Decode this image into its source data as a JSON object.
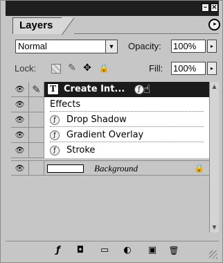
{
  "window": {
    "minimize_glyph": "–",
    "close_glyph": "×"
  },
  "panel": {
    "tab_label": "Layers",
    "menu_icon": "panel-menu-arrow-icon",
    "menu_glyph": "▸"
  },
  "blend": {
    "mode": "Normal",
    "arrow_glyph": "▼"
  },
  "opacity": {
    "label": "Opacity:",
    "value": "100%",
    "arrow_glyph": "▸"
  },
  "lock": {
    "label": "Lock:",
    "icons": [
      "lock-transparent-icon",
      "lock-image-brush-icon",
      "lock-position-move-icon",
      "lock-all-padlock-icon"
    ],
    "brush_glyph": "✎",
    "move_glyph": "✥",
    "padlock_glyph": "🔒"
  },
  "fill": {
    "label": "Fill:",
    "value": "100%",
    "arrow_glyph": "▸"
  },
  "layers": {
    "selected": {
      "name": "Create Int...",
      "thumb_glyph": "T",
      "fx_glyph": "ƒ",
      "eye_glyph": "👁",
      "brush_glyph": "✎",
      "cursor_glyph": "☝"
    },
    "effects_label": "Effects",
    "effects": [
      {
        "name": "Drop Shadow",
        "fx_glyph": "ƒ"
      },
      {
        "name": "Gradient Overlay",
        "fx_glyph": "ƒ"
      },
      {
        "name": "Stroke",
        "fx_glyph": "ƒ"
      }
    ],
    "background": {
      "name": "Background",
      "lock_glyph": "🔒"
    }
  },
  "scrollbar": {
    "up_glyph": "▲",
    "down_glyph": "▼"
  },
  "bottom_icons": [
    {
      "name": "add-layer-style-icon",
      "glyph": "ƒ"
    },
    {
      "name": "add-layer-mask-icon",
      "glyph": "◘"
    },
    {
      "name": "new-layer-set-icon",
      "glyph": "▭"
    },
    {
      "name": "new-fill-adjustment-layer-icon",
      "glyph": "◐"
    },
    {
      "name": "create-new-layer-icon",
      "glyph": "▣"
    },
    {
      "name": "delete-layer-icon",
      "glyph": "🗑"
    }
  ]
}
